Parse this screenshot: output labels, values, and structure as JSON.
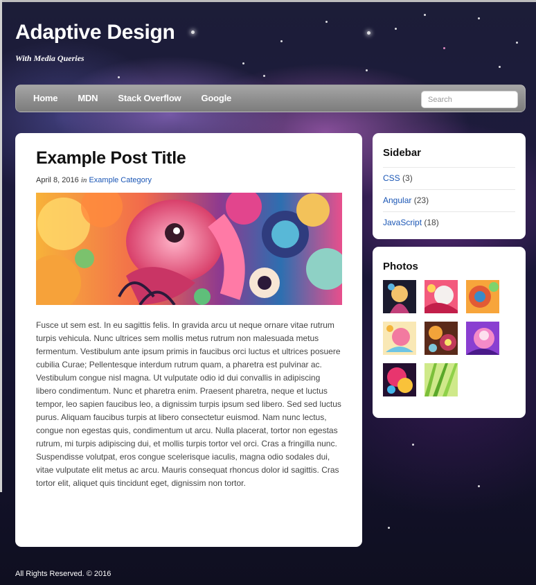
{
  "header": {
    "site_title": "Adaptive Design",
    "tagline": "With Media Queries"
  },
  "nav": {
    "links": [
      "Home",
      "MDN",
      "Stack Overflow",
      "Google"
    ],
    "search_placeholder": "Search"
  },
  "post": {
    "title": "Example Post Title",
    "date": "April 8, 2016",
    "in_word": "in",
    "category": "Example Category",
    "body": "Fusce ut sem est. In eu sagittis felis. In gravida arcu ut neque ornare vitae rutrum turpis vehicula. Nunc ultrices sem mollis metus rutrum non malesuada metus fermentum. Vestibulum ante ipsum primis in faucibus orci luctus et ultrices posuere cubilia Curae; Pellentesque interdum rutrum quam, a pharetra est pulvinar ac. Vestibulum congue nisl magna. Ut vulputate odio id dui convallis in adipiscing libero condimentum. Nunc et pharetra enim. Praesent pharetra, neque et luctus tempor, leo sapien faucibus leo, a dignissim turpis ipsum sed libero. Sed sed luctus purus. Aliquam faucibus turpis at libero consectetur euismod. Nam nunc lectus, congue non egestas quis, condimentum ut arcu. Nulla placerat, tortor non egestas rutrum, mi turpis adipiscing dui, et mollis turpis tortor vel orci. Cras a fringilla nunc. Suspendisse volutpat, eros congue scelerisque iaculis, magna odio sodales dui, vitae vulputate elit metus ac arcu. Mauris consequat rhoncus dolor id sagittis. Cras tortor elit, aliquet quis tincidunt eget, dignissim non tortor."
  },
  "sidebar": {
    "title": "Sidebar",
    "categories": [
      {
        "name": "CSS",
        "count": "(3)"
      },
      {
        "name": "Angular",
        "count": "(23)"
      },
      {
        "name": "JavaScript",
        "count": "(18)"
      }
    ]
  },
  "photos": {
    "title": "Photos"
  },
  "footer": {
    "text": "All Rights Reserved. © 2016"
  },
  "colors": {
    "link": "#1a56b5",
    "nav_bar": "#8e8e8e",
    "panel": "#ffffff"
  }
}
